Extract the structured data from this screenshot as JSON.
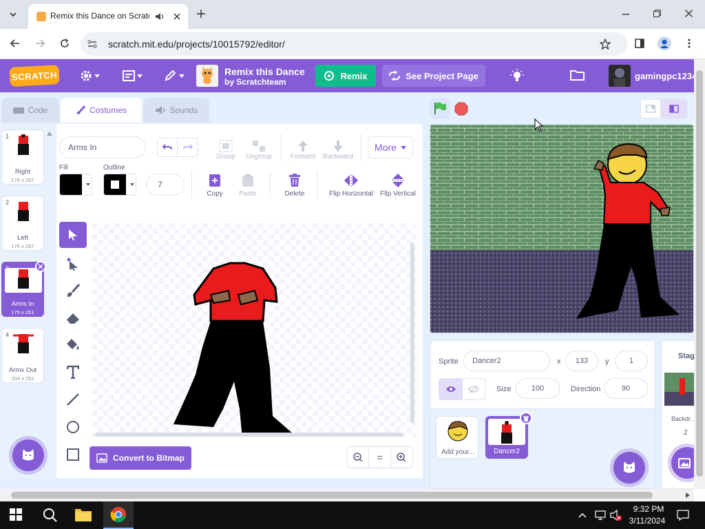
{
  "browser": {
    "tab_title": "Remix this Dance on Scratch",
    "url": "scratch.mit.edu/projects/10015792/editor/"
  },
  "menubar": {
    "logo": "SCRATCH",
    "project_title": "Remix this Dance",
    "project_author": "by Scratchteam",
    "remix_label": "Remix",
    "see_project_label": "See Project Page",
    "username": "gamingpc1234"
  },
  "tabs": {
    "code": "Code",
    "costumes": "Costumes",
    "sounds": "Sounds"
  },
  "costumes": [
    {
      "num": "1",
      "name": "Right",
      "dims": "176 x 267",
      "selected": false
    },
    {
      "num": "2",
      "name": "Left",
      "dims": "176 x 267",
      "selected": false
    },
    {
      "num": "3",
      "name": "Arms In",
      "dims": "175 x 251",
      "selected": true
    },
    {
      "num": "4",
      "name": "Arms Out",
      "dims": "204 x 252",
      "selected": false
    }
  ],
  "paint": {
    "costume_name": "Arms In",
    "fill_label": "Fill",
    "outline_label": "Outline",
    "outline_width": "7",
    "group": "Group",
    "ungroup": "Ungroup",
    "forward": "Forward",
    "backward": "Backward",
    "more": "More",
    "copy": "Copy",
    "paste": "Paste",
    "delete": "Delete",
    "flip_h": "Flip Horizontal",
    "flip_v": "Flip Vertical",
    "convert": "Convert to Bitmap",
    "zoom_reset": "="
  },
  "sprite": {
    "sprite_label": "Sprite",
    "name": "Dancer2",
    "x_label": "x",
    "x": "133",
    "y_label": "y",
    "y": "1",
    "size_label": "Size",
    "size": "100",
    "direction_label": "Direction",
    "direction": "90",
    "sprites": [
      {
        "name": "Add your...",
        "selected": false
      },
      {
        "name": "Dancer2",
        "selected": true
      }
    ]
  },
  "stage": {
    "label": "Stage",
    "backdrops_label": "Backdr...",
    "backdrops_count": "2"
  },
  "taskbar": {
    "time": "9:32 PM",
    "date": "3/11/2024"
  },
  "colors": {
    "menu_purple": "#855cd6",
    "remix_green": "#0fbd8c",
    "flag_green": "#4cbf56",
    "stop_red": "#ec5959"
  }
}
